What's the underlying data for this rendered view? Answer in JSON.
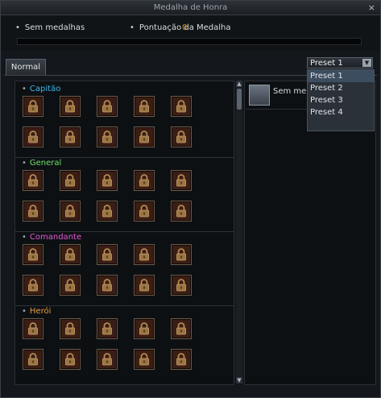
{
  "window": {
    "title": "Medalha de Honra",
    "close_glyph": "×"
  },
  "info": {
    "medals_label": "Sem medalhas",
    "points_label": "Pontuação d",
    "points_overlap_label": "a Medalha",
    "points_value": "0",
    "progress_fraction": 0.0
  },
  "tabs": [
    {
      "label": "Normal"
    }
  ],
  "selected_medal": {
    "label": "Sem meda"
  },
  "preset_dropdown": {
    "selected": "Preset 1",
    "options": [
      "Preset 1",
      "Preset 2",
      "Preset 3",
      "Preset 4"
    ],
    "highlighted_index": 0
  },
  "ranks": [
    {
      "name": "Capitão",
      "color": "#3bb8e8"
    },
    {
      "name": "General",
      "color": "#6ee26a"
    },
    {
      "name": "Comandante",
      "color": "#e25ad6"
    },
    {
      "name": "Herói",
      "color": "#e7a044"
    }
  ],
  "icons": {
    "lock": "lock-icon",
    "close": "close-icon",
    "scroll_up": "scroll-up-icon",
    "scroll_down": "scroll-down-icon",
    "dropdown": "chevron-down-icon"
  }
}
